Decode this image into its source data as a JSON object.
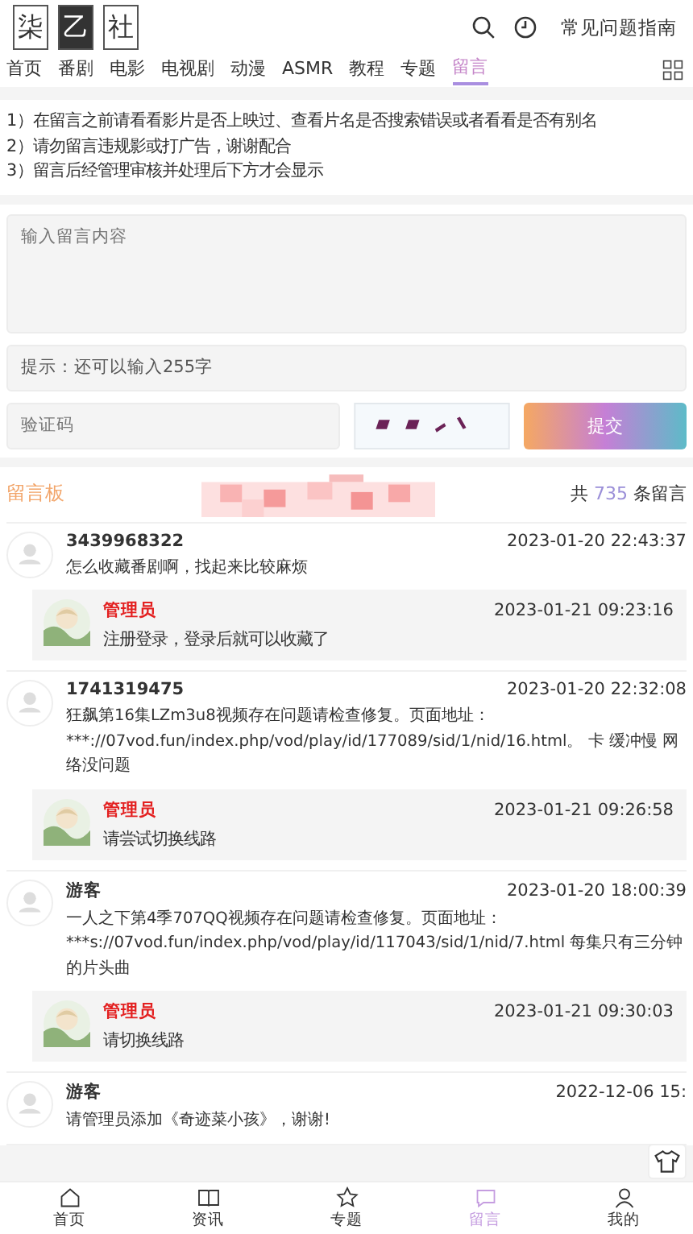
{
  "logo": [
    "柒",
    "乙",
    "社"
  ],
  "header": {
    "help_link": "常见问题指南"
  },
  "nav": [
    {
      "label": "首页",
      "selected": false
    },
    {
      "label": "番剧",
      "selected": false
    },
    {
      "label": "电影",
      "selected": false
    },
    {
      "label": "电视剧",
      "selected": false
    },
    {
      "label": "动漫",
      "selected": false
    },
    {
      "label": "ASMR",
      "selected": false
    },
    {
      "label": "教程",
      "selected": false
    },
    {
      "label": "专题",
      "selected": false
    },
    {
      "label": "留言",
      "selected": true
    }
  ],
  "notices": [
    "1）在留言之前请看看影片是否上映过、查看片名是否搜索错误或者看看是否有别名",
    "2）请勿留言违规影或打广告，谢谢配合",
    "3）留言后经管理审核并处理后下方才会显示"
  ],
  "form": {
    "message_placeholder": "输入留言内容",
    "hint": "提示：还可以输入255字",
    "captcha_placeholder": "验证码",
    "submit": "提交"
  },
  "board": {
    "title": "留言板",
    "count_prefix": "共",
    "count": "735",
    "count_suffix": "条留言"
  },
  "comments": [
    {
      "user": "3439968322",
      "time": "2023-01-20 22:43:37",
      "text": "怎么收藏番剧啊，找起来比较麻烦",
      "reply": {
        "user": "管理员",
        "time": "2023-01-21 09:23:16",
        "text": "注册登录，登录后就可以收藏了"
      }
    },
    {
      "user": "1741319475",
      "time": "2023-01-20 22:32:08",
      "text": "狂飙第16集LZm3u8视频存在问题请检查修复。页面地址：***://07vod.fun/index.php/vod/play/id/177089/sid/1/nid/16.html。 卡 缓冲慢 网络没问题",
      "reply": {
        "user": "管理员",
        "time": "2023-01-21 09:26:58",
        "text": "请尝试切换线路"
      }
    },
    {
      "user": "游客",
      "time": "2023-01-20 18:00:39",
      "text": "一人之下第4季707QQ视频存在问题请检查修复。页面地址：***s://07vod.fun/index.php/vod/play/id/117043/sid/1/nid/7.html 每集只有三分钟的片头曲",
      "reply": {
        "user": "管理员",
        "time": "2023-01-21 09:30:03",
        "text": "请切换线路"
      }
    },
    {
      "user": "游客",
      "time": "2022-12-06 15:",
      "text": "请管理员添加《奇迹菜小孩》，谢谢!"
    }
  ],
  "bottom_nav": [
    {
      "label": "首页",
      "selected": false
    },
    {
      "label": "资讯",
      "selected": false
    },
    {
      "label": "专题",
      "selected": false
    },
    {
      "label": "留言",
      "selected": true
    },
    {
      "label": "我的",
      "selected": false
    }
  ]
}
